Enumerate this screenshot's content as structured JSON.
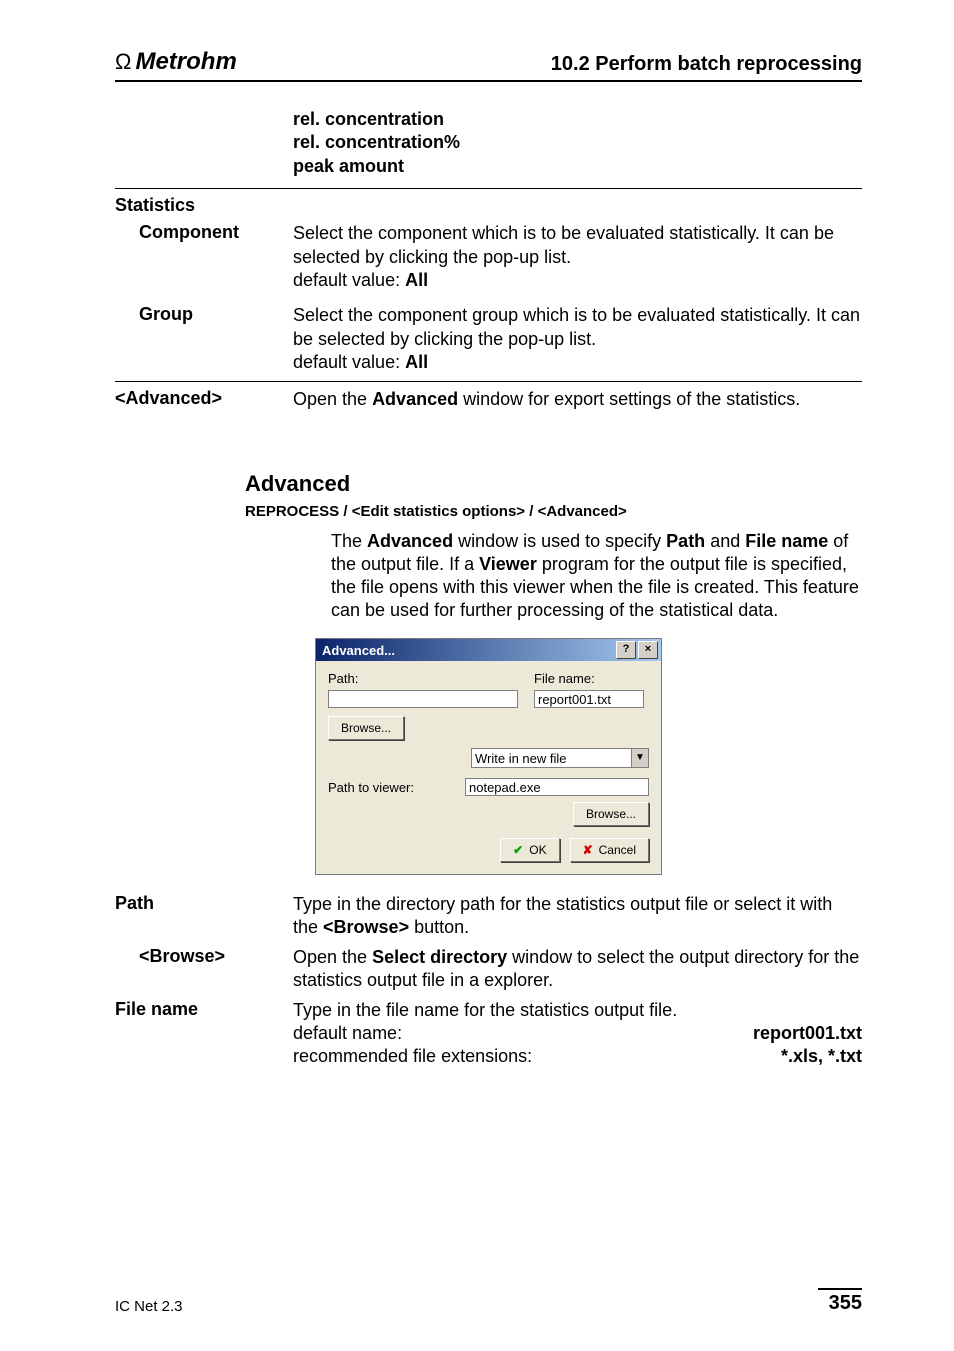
{
  "header": {
    "brand": "Metrohm",
    "section": "10.2  Perform batch reprocessing"
  },
  "top_list": {
    "l1": "rel. concentration",
    "l2": "rel. concentration%",
    "l3": "peak amount"
  },
  "statistics_label": "Statistics",
  "rows": {
    "component": {
      "label": "Component",
      "desc1": "Select the component which is to be evaluated statistically. It can be selected by clicking the pop-up list.",
      "desc2a": "default value: ",
      "desc2b": "All"
    },
    "group": {
      "label": "Group",
      "desc1": "Select the component group which is to be evaluated statistically. It can be selected by clicking the pop-up list.",
      "desc2a": "default value: ",
      "desc2b": "All"
    },
    "advanced": {
      "label": "<Advanced>",
      "d1": "Open the ",
      "d2": "Advanced",
      "d3": " window for export settings of the statistics."
    }
  },
  "advanced_heading": "Advanced",
  "breadcrumb": "REPROCESS / <Edit statistics options> / <Advanced>",
  "intro": {
    "p1a": "The ",
    "p1b": "Advanced",
    "p1c": " window is used to specify ",
    "p1d": "Path",
    "p1e": " and ",
    "p1f": "File name",
    "p1g": " of the output file. If a ",
    "p1h": "Viewer",
    "p1i": " program for the output file is specified, the file opens with this viewer when the file is created. This feature can be used for further processing of the statistical data."
  },
  "dialog": {
    "title": "Advanced...",
    "path_label": "Path:",
    "filename_label": "File name:",
    "filename_value": "report001.txt",
    "browse1": "Browse...",
    "select_value": "Write in new file",
    "pathviewer_label": "Path to viewer:",
    "pathviewer_value": "notepad.exe",
    "browse2": "Browse...",
    "ok": "OK",
    "cancel": "Cancel"
  },
  "bottom": {
    "path": {
      "label": "Path",
      "d1": "Type in the directory path for the statistics output file or select it with the ",
      "d2": "<Browse>",
      "d3": " button."
    },
    "browse": {
      "label": "<Browse>",
      "d1": "Open the ",
      "d2": "Select directory",
      "d3": " window to select the output directory for the statistics output file in a explorer."
    },
    "filename": {
      "label": "File name",
      "d1": "Type in the file name for the statistics output file.",
      "dn_l": "default name:",
      "dn_r": "report001.txt",
      "ext_l": "recommended file extensions:",
      "ext_r": "*.xls, *.txt"
    }
  },
  "footer": {
    "product": "IC Net 2.3",
    "page": "355"
  }
}
